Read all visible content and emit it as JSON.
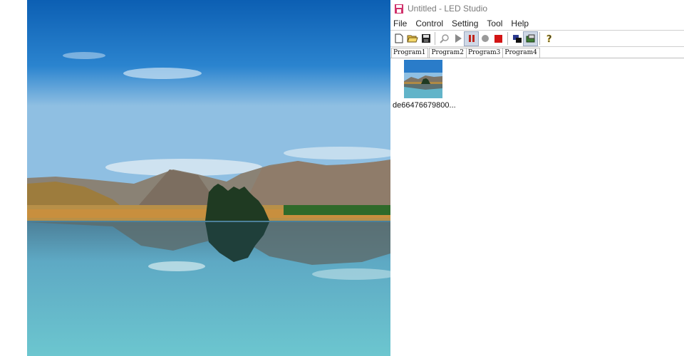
{
  "window": {
    "title": "Untitled - LED Studio"
  },
  "menu": {
    "items": [
      "File",
      "Control",
      "Setting",
      "Tool",
      "Help"
    ]
  },
  "toolbar": {
    "icons": [
      "new-file-icon",
      "open-folder-icon",
      "save-icon",
      "zoom-icon",
      "play-icon",
      "pause-icon",
      "stop-circle-icon",
      "stop-square-icon",
      "window-mode-icon",
      "display-icon",
      "help-icon"
    ]
  },
  "tabs": [
    "Program1",
    "Program2",
    "Program3",
    "Program4"
  ],
  "media": {
    "filename": "de66476679800..."
  },
  "colors": {
    "tab_active": "Program1",
    "record_red": "#d31414",
    "pause_red": "#c0261b",
    "title_icon": "#d0316b"
  }
}
